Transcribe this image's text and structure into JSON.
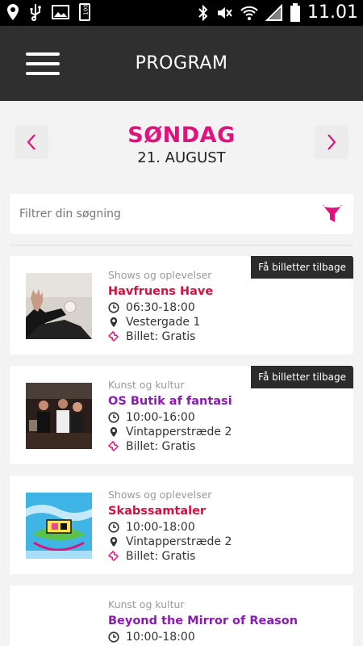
{
  "status_bar": {
    "time": "11.01",
    "battery": "100"
  },
  "header": {
    "title": "PROGRAM"
  },
  "date_nav": {
    "day": "SØNDAG",
    "date": "21. AUGUST"
  },
  "search": {
    "placeholder": "Filtrer din søgning"
  },
  "colors": {
    "accent": "#e0127e",
    "red_title": "#d0123f",
    "purple_title": "#8a1ab5",
    "header_bg": "#2f2f2f"
  },
  "events": [
    {
      "category": "Shows og oplevelser",
      "title": "Havfruens Have",
      "title_color": "#d0123f",
      "time": "06:30-18:00",
      "location": "Vestergade 1",
      "price": "Billet: Gratis",
      "badge": "Få billetter tilbage",
      "image": "photo-person-arm-raised"
    },
    {
      "category": "Kunst og kultur",
      "title": "OS Butik af fantasi",
      "title_color": "#8a1ab5",
      "time": "10:00-16:00",
      "location": "Vintapperstræde 2",
      "price": "Billet: Gratis",
      "badge": "Få billetter tilbage",
      "image": "photo-band-on-stage"
    },
    {
      "category": "Shows og oplevelser",
      "title": "Skabssamtaler",
      "title_color": "#d0123f",
      "time": "10:00-18:00",
      "location": "Vintapperstræde 2",
      "price": "Billet: Gratis",
      "badge": "",
      "image": "illustration-colorful-boat"
    },
    {
      "category": "Kunst og kultur",
      "title": "Beyond the Mirror of Reason",
      "title_color": "#8a1ab5",
      "time": "10:00-18:00",
      "location": "",
      "price": "",
      "badge": "",
      "image": ""
    }
  ],
  "icons": {
    "clock": "clock-icon",
    "location": "map-pin-icon",
    "ticket": "ticket-icon",
    "filter": "funnel-icon",
    "prev": "chevron-left-icon",
    "next": "chevron-right-icon",
    "menu": "hamburger-menu-icon"
  }
}
